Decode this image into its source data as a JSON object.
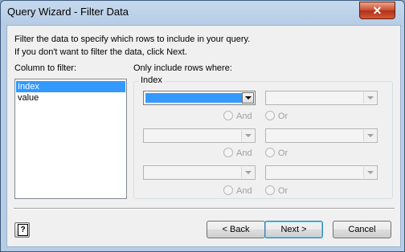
{
  "window": {
    "title": "Query Wizard - Filter Data",
    "close_glyph": "✕"
  },
  "instructions": {
    "line1": "Filter the data to specify which rows to include in your query.",
    "line2": "If you don't want to filter the data, click Next."
  },
  "columns": {
    "label": "Column to filter:",
    "items": [
      "Index",
      "value"
    ],
    "selected": "Index"
  },
  "criteria": {
    "label": "Only include rows where:",
    "group_label": "Index",
    "rows": [
      {
        "operator": "",
        "value": "",
        "and_label": "And",
        "or_label": "Or"
      },
      {
        "operator": "",
        "value": "",
        "and_label": "And",
        "or_label": "Or"
      },
      {
        "operator": "",
        "value": "",
        "and_label": "And",
        "or_label": "Or"
      }
    ]
  },
  "buttons": {
    "help": "?",
    "back": "< Back",
    "next": "Next >",
    "cancel": "Cancel"
  },
  "colors": {
    "selection": "#3399ff",
    "titlebar": "#b7cde6",
    "close": "#c84a2b"
  }
}
